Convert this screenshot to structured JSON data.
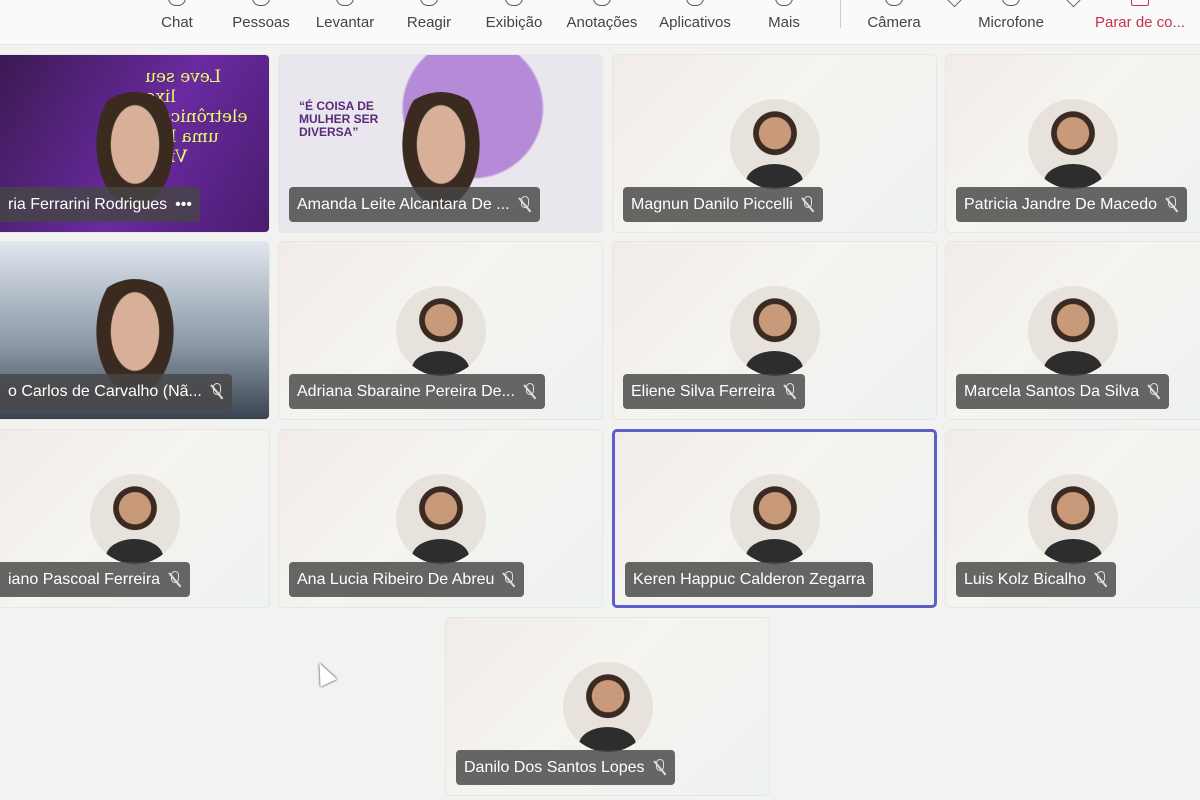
{
  "toolbar": {
    "items": [
      {
        "label": "Chat",
        "icon": "chat-icon"
      },
      {
        "label": "Pessoas",
        "icon": "people-icon"
      },
      {
        "label": "Levantar",
        "icon": "raise-hand-icon"
      },
      {
        "label": "Reagir",
        "icon": "react-icon"
      },
      {
        "label": "Exibição",
        "icon": "view-icon"
      },
      {
        "label": "Anotações",
        "icon": "notes-icon"
      },
      {
        "label": "Aplicativos",
        "icon": "apps-icon"
      },
      {
        "label": "Mais",
        "icon": "more-icon"
      },
      {
        "label": "Câmera",
        "icon": "camera-icon"
      },
      {
        "label": "Microfone",
        "icon": "microphone-icon"
      },
      {
        "label": "Parar de co...",
        "icon": "stop-sharing-icon"
      }
    ],
    "stop_color": "#c4314b"
  },
  "participants": [
    {
      "name": "ria Ferrarini Rodrigues",
      "video": true,
      "more": "•••",
      "bg_text": "Leve seu lixo eletrônico a uma loja Vivo."
    },
    {
      "name": "Amanda Leite Alcantara De ...",
      "video": true,
      "muted": true,
      "bg_text": "“É COISA DE MULHER SER DIVERSA”"
    },
    {
      "name": "Magnun Danilo Piccelli",
      "muted": true
    },
    {
      "name": "Patricia Jandre De Macedo",
      "muted": true
    },
    {
      "name": "o Carlos de Carvalho (Nã...",
      "video": true,
      "muted": true
    },
    {
      "name": "Adriana Sbaraine Pereira De...",
      "muted": true
    },
    {
      "name": "Eliene Silva Ferreira",
      "muted": true
    },
    {
      "name": "Marcela Santos Da Silva",
      "muted": true
    },
    {
      "name": "iano Pascoal Ferreira",
      "muted": true
    },
    {
      "name": "Ana Lucia Ribeiro De Abreu",
      "muted": true
    },
    {
      "name": "Keren Happuc Calderon Zegarra",
      "active": true
    },
    {
      "name": "Luis Kolz Bicalho",
      "muted": true
    },
    {
      "name": "Danilo Dos Santos Lopes",
      "muted": true
    }
  ],
  "active_speaker_color": "#5b5fc7"
}
